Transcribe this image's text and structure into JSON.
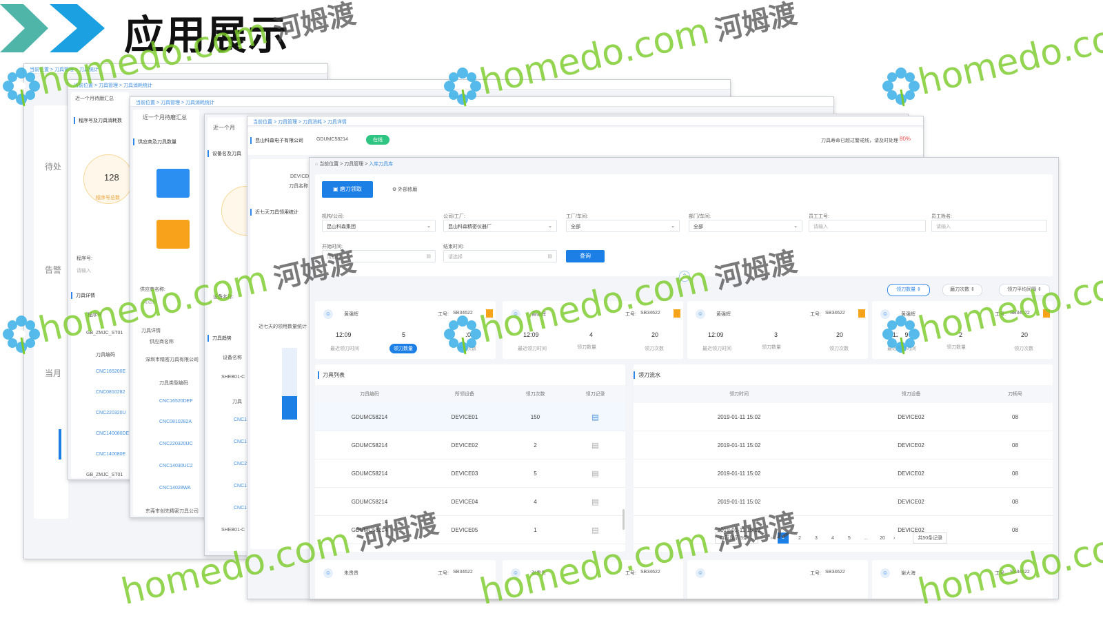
{
  "slide": {
    "title": "应用展示",
    "watermark_text": "homedo.com",
    "watermark_cn": "河姆渡"
  },
  "colors": {
    "chevron_a": "#4fb5a8",
    "chevron_b": "#1ba0e2",
    "accent": "#1c7fe6",
    "watermark": "#7bcb2b"
  },
  "layer1": {
    "breadcrumb": "当前位置 > 刀具管理 > 刀具统计",
    "side_text_1": "待处",
    "side_text_2": "告警",
    "side_text_3": "当月"
  },
  "layer2": {
    "header": "近一个月待磨汇总",
    "breadcrumb": "当前位置 > 刀具管理 > 刀具消耗统计",
    "sec_device": "程序号及刀具消耗数",
    "gauge_value": "128",
    "gauge_label": "程序号总数",
    "f_label": "程序号:",
    "f_placeholder": "请输入",
    "sec_detail": "刀具详情",
    "col_prog": "程序号",
    "prog_1": "GB_ZMJC_ST01",
    "col_code": "刀具编码",
    "codes": [
      "CNC165200E",
      "CNC0810282",
      "CNC220320U",
      "CNC140080DE",
      "CNC140080E"
    ],
    "prog_2": "GB_ZMJC_ST01"
  },
  "layer3": {
    "header": "近一个月待磨汇总",
    "breadcrumb": "当前位置 > 刀具管理 > 刀具消耗统计",
    "sec": "供应商及刀具数量",
    "f_label": "供应商名称:",
    "f_placeholder": "请选择",
    "sec_detail": "刀具详情",
    "col_supplier": "供应商名称",
    "supplier_1": "深圳市精密刀具有限公司",
    "col_code": "刀具类型编码",
    "codes": [
      "CNC16520DEF",
      "CNC0810282A",
      "CNC220320UC",
      "CNC14030UC2",
      "CNC14028WA"
    ],
    "supplier_2": "东莞市创先精密刀具公司"
  },
  "layer4": {
    "header": "近一个月",
    "sec": "设备名及刀具",
    "sec_trend": "刀具趋势",
    "device_label": "设备名称:",
    "col_device": "设备名称",
    "devices": [
      "SHEB01-C",
      "SHEB01-C"
    ],
    "col_tool": "刀具",
    "tool_codes": [
      "CNC1",
      "CNC1",
      "CNC2",
      "CNC1",
      "CNC1"
    ]
  },
  "layer5": {
    "breadcrumb": "当前位置 > 刀具管理 > 刀具消耗 > 刀具详情",
    "company": "昆山科森电子有限公司",
    "code": "GDUMC58214",
    "status": "在线",
    "alert": "刀具寿命已超过警戒线，请及时处理",
    "alert_pct": "80%",
    "sec_chart": "近七天刀具领用统计",
    "chart_title": "近七天的领用数量统计",
    "device": "DEVICE01",
    "device_label": "刀具名称"
  },
  "main": {
    "breadcrumb": [
      "当前位置",
      "刀具管理",
      "入库刀具库"
    ],
    "tab_active": "磨刀领取",
    "tab_other": "外部修磨",
    "filters": [
      {
        "label": "机构/公司:",
        "value": "昆山科森集团"
      },
      {
        "label": "公司/工厂:",
        "value": "昆山科森精密仪器厂"
      },
      {
        "label": "工厂/车间:",
        "value": "全部"
      },
      {
        "label": "部门/车间:",
        "value": "全部"
      },
      {
        "label": "员工工号:",
        "value": "请输入"
      },
      {
        "label": "员工姓名:",
        "value": "请输入"
      }
    ],
    "start_label": "开始时间:",
    "start_placeholder": "请选择",
    "end_label": "结束时间:",
    "end_placeholder": "请选择",
    "query_button": "查询",
    "sort_buttons": [
      "领刀数量",
      "磨刀次数",
      "领刀平均间隔"
    ],
    "employees": [
      {
        "name": "黄强辉",
        "id_label": "工号:",
        "id": "SB34622",
        "time": "12:09",
        "time_label": "最近领刀时间",
        "count": "5",
        "count_label": "领刀数量",
        "total": "20",
        "total_label": "领刀次数"
      },
      {
        "name": "黄强辉",
        "id_label": "工号:",
        "id": "SB34622",
        "time": "12:09",
        "time_label": "最近领刀时间",
        "count": "4",
        "count_label": "领刀数量",
        "total": "20",
        "total_label": "领刀次数"
      },
      {
        "name": "黄强辉",
        "id_label": "工号:",
        "id": "SB34622",
        "time": "12:09",
        "time_label": "最近领刀时间",
        "count": "3",
        "count_label": "领刀数量",
        "total": "20",
        "total_label": "领刀次数"
      },
      {
        "name": "黄强辉",
        "id_label": "工号:",
        "id": "SB34622",
        "time": "12:09",
        "time_label": "最近领刀时间",
        "count": "2",
        "count_label": "领刀数量",
        "total": "20",
        "total_label": "领刀次数"
      }
    ],
    "tool_list": {
      "title": "刀具列表",
      "headers": [
        "刀具编码",
        "所领设备",
        "领刀次数",
        "领刀记录"
      ],
      "rows": [
        [
          "GDUMC58214",
          "DEVICE01",
          "150"
        ],
        [
          "GDUMC58214",
          "DEVICE02",
          "2"
        ],
        [
          "GDUMC58214",
          "DEVICE03",
          "5"
        ],
        [
          "GDUMC58214",
          "DEVICE04",
          "4"
        ],
        [
          "GDUMC58214",
          "DEVICE05",
          "1"
        ]
      ]
    },
    "flow": {
      "title": "领刀流水",
      "headers": [
        "领刀时间",
        "领刀设备",
        "刀柄号"
      ],
      "rows": [
        [
          "2019-01-11 15:02",
          "DEVICE02",
          "08"
        ],
        [
          "2019-01-11 15:02",
          "DEVICE02",
          "08"
        ],
        [
          "2019-01-11 15:02",
          "DEVICE02",
          "08"
        ],
        [
          "2019-01-11 15:02",
          "DEVICE02",
          "08"
        ],
        [
          "2019-01-11 15:02",
          "DEVICE02",
          "08"
        ]
      ]
    },
    "pagination": {
      "page_size": "每页显示 5条",
      "pages": [
        "1",
        "2",
        "3",
        "4",
        "5",
        "...",
        "20"
      ],
      "total": "共50条记录"
    },
    "bottom_employees": [
      {
        "name": "朱贵贵",
        "id_label": "工号:",
        "id": "SB34622"
      },
      {
        "name": "张贵贵",
        "id_label": "工号:",
        "id": "SB34622"
      },
      {
        "name": "",
        "id_label": "工号:",
        "id": "SB34622"
      },
      {
        "name": "谢大海",
        "id_label": "工号:",
        "id": "SB34622"
      }
    ]
  }
}
